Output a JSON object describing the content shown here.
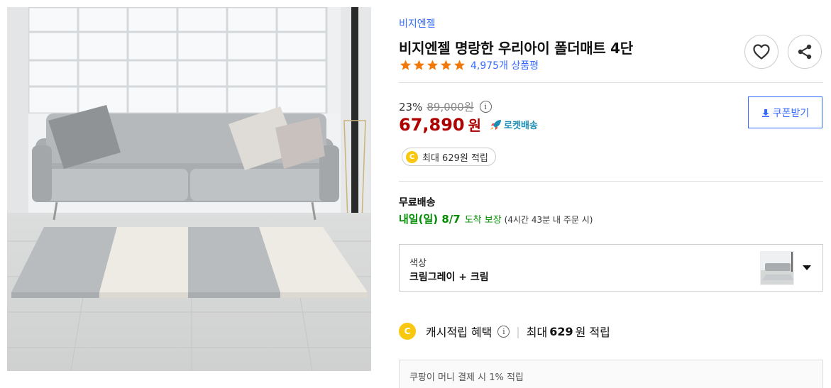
{
  "product": {
    "brand": "비지엔젤",
    "title": "비지엔젤 명랑한 우리아이 폴더매트 4단",
    "rating": 5,
    "review_count": "4,975개 상품평",
    "image_alt": "폴더매트 4단 제품 사진"
  },
  "actions": {
    "wishlist_icon": "heart-icon",
    "share_icon": "share-icon"
  },
  "price": {
    "discount_rate": "23%",
    "original_price": "89,000원",
    "sale_price": "67,890",
    "sale_unit": "원",
    "info_glyph": "i",
    "rocket_label": "로켓배송",
    "coupon_button": "쿠폰받기",
    "coin_glyph": "C",
    "reward_points": "최대 629원 적립"
  },
  "shipping": {
    "fee_label": "무료배송",
    "delivery_date": "내일(일) 8/7",
    "guarantee": "도착 보장",
    "order_note": "(4시간 43분 내 주문 시)"
  },
  "option": {
    "label": "색상",
    "value": "크림그레이 + 크림"
  },
  "cash_benefit": {
    "label": "캐시적립 혜택",
    "separator": "|",
    "prefix": "최대",
    "amount": "629",
    "suffix": "원 적립"
  },
  "bottom_note": "쿠팡이 머니 결제 시 1% 적립",
  "colors": {
    "accent": "#346aff",
    "price": "#ae0000",
    "delivery": "#008c00",
    "rocket": "#1d8db5",
    "coin": "#f9c80e"
  }
}
